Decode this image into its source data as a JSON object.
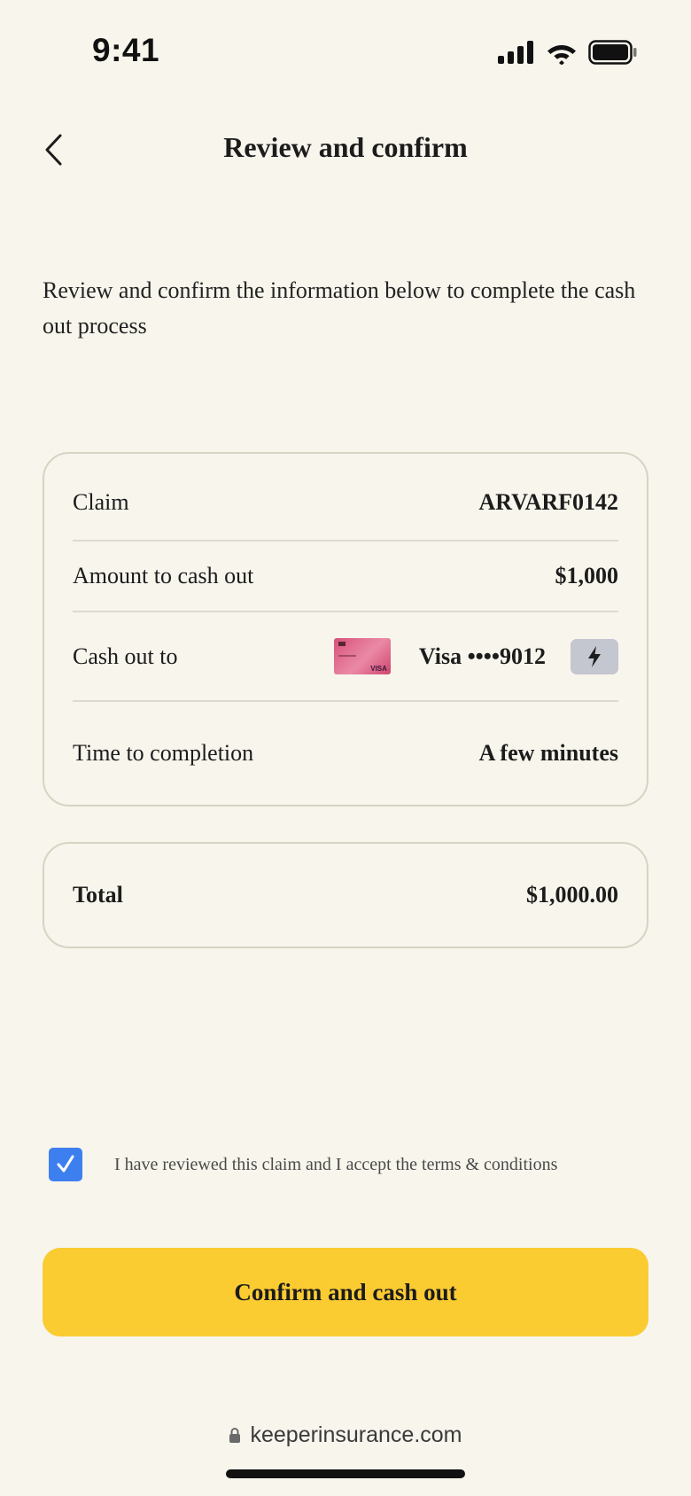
{
  "status_bar": {
    "time": "9:41",
    "icons": [
      "signal-icon",
      "wifi-icon",
      "battery-icon"
    ]
  },
  "header": {
    "back_icon": "chevron-left-icon",
    "title": "Review and confirm"
  },
  "intro_text": "Review and confirm the information below to complete the cash out process",
  "details": {
    "claim_label": "Claim",
    "claim_value": "ARVARF0142",
    "amount_label": "Amount to cash out",
    "amount_value": "$1,000",
    "cashout_label": "Cash out to",
    "card_brand_mark": "VISA",
    "card_text": "Visa ••••9012",
    "instant_icon": "lightning-bolt-icon",
    "time_label": "Time to completion",
    "time_value": "A few minutes"
  },
  "total": {
    "label": "Total",
    "value": "$1,000.00"
  },
  "terms": {
    "checked": true,
    "text": "I have reviewed this claim and I accept the terms & conditions"
  },
  "cta_label": "Confirm and cash out",
  "browser": {
    "url": "keeperinsurance.com",
    "lock_icon": "lock-icon"
  },
  "colors": {
    "background": "#f7f5ec",
    "card_border": "#d6d4c2",
    "cta": "#fbcb32",
    "checkbox": "#3e7ff0",
    "bolt_chip": "#c4c6d0",
    "card_pink": "#e26a8e"
  }
}
